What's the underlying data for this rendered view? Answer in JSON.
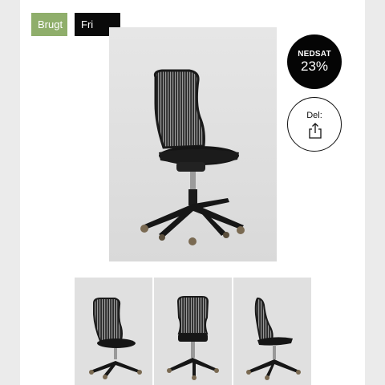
{
  "badges": {
    "used": "Brugt",
    "free_shipping": "Fri fragt"
  },
  "discount": {
    "label": "NEDSAT",
    "percent": "23%"
  },
  "share": {
    "label": "Del:",
    "icon": "share-icon"
  },
  "colors": {
    "used_badge": "#8fae6b",
    "free_shipping_badge": "#0a0a0a",
    "discount_circle": "#050505",
    "photo_background": "#e1e1e1"
  }
}
